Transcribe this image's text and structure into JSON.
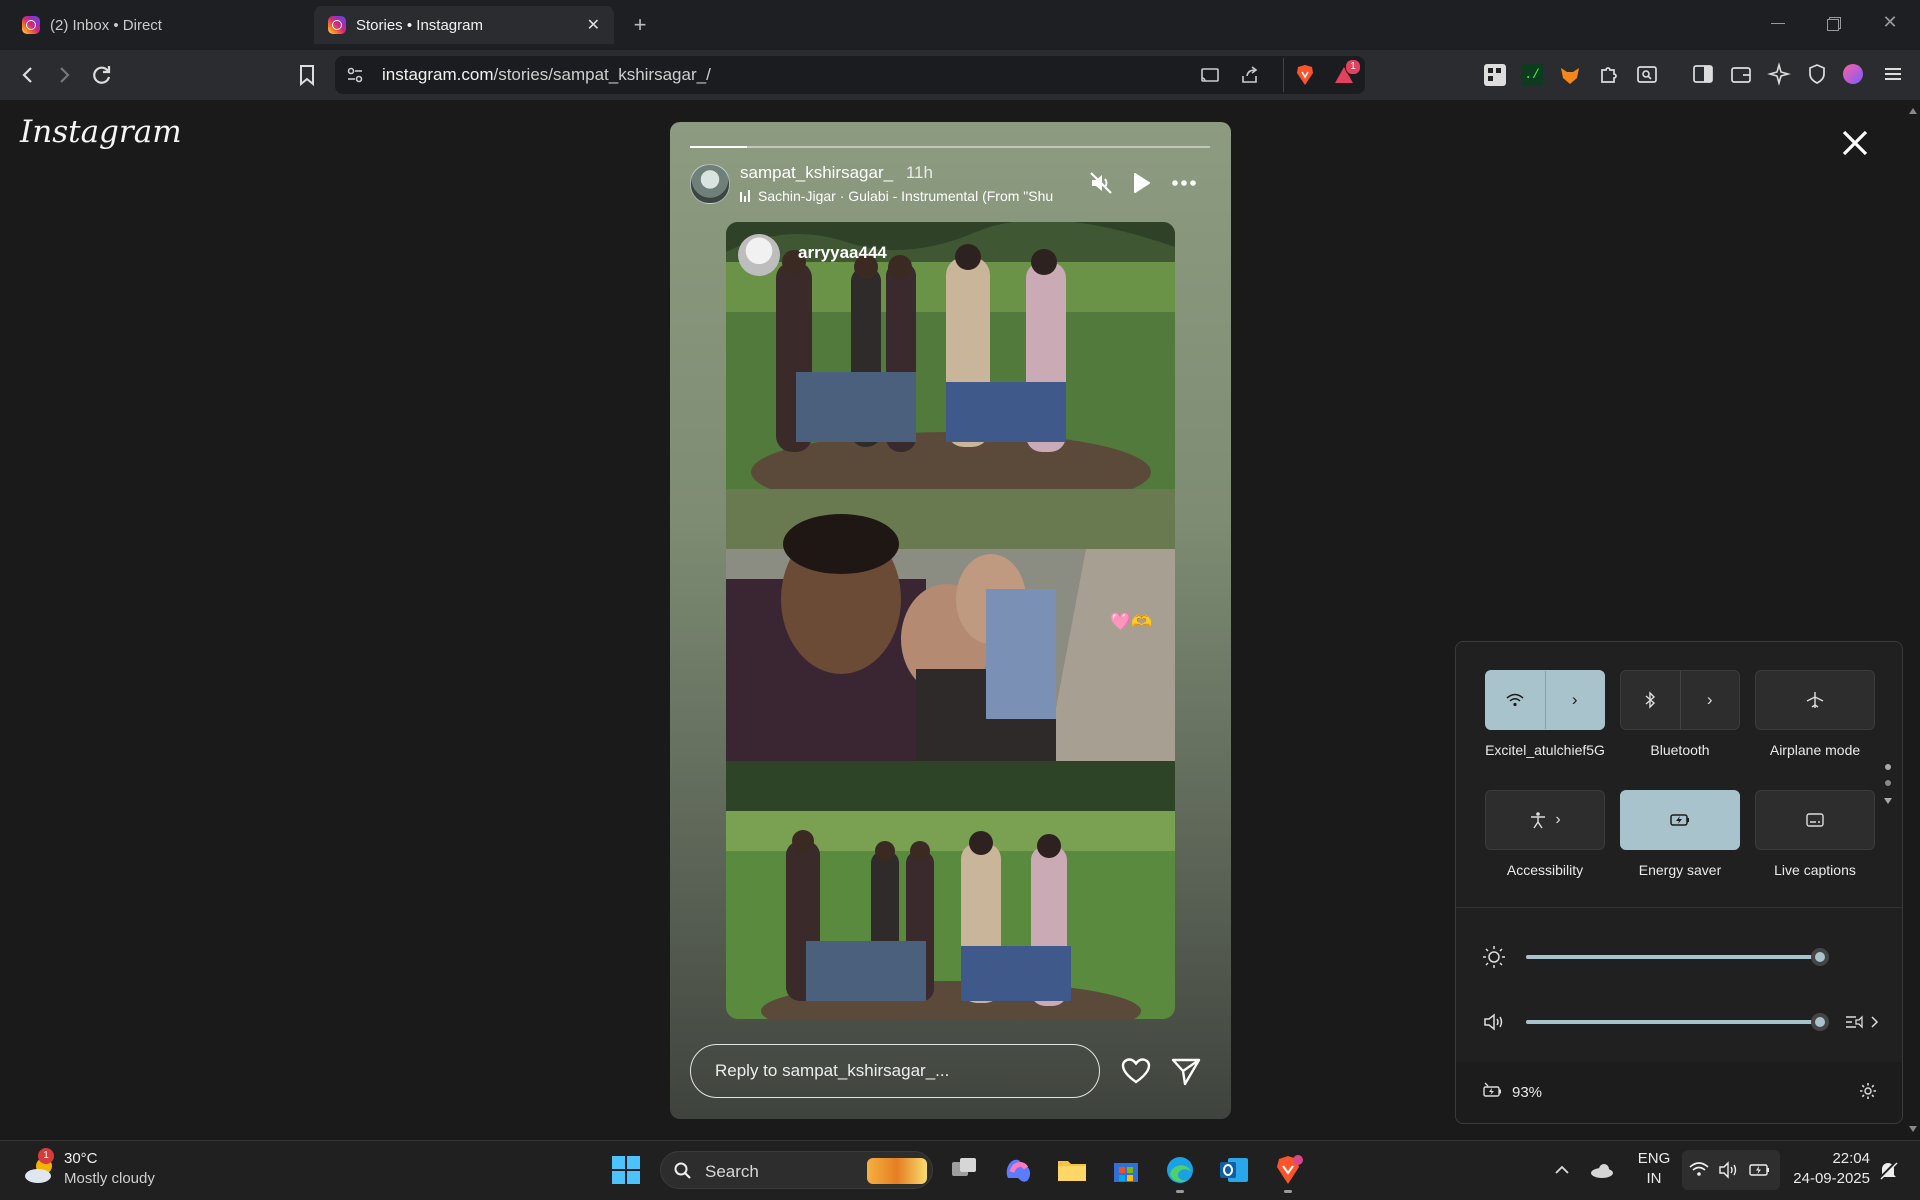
{
  "browser": {
    "tabs": [
      {
        "label": "(2) Inbox • Direct",
        "active": false
      },
      {
        "label": "Stories • Instagram",
        "active": true
      }
    ],
    "url_domain": "instagram.com",
    "url_path": "/stories/sampat_kshirsagar_/",
    "notification_count": "1"
  },
  "instagram": {
    "logo_text": "Instagram"
  },
  "story": {
    "username": "sampat_kshirsagar_",
    "time_ago": "11h",
    "music_text": "Sachin-Jigar · Gulabi - Instrumental (From \"Shu",
    "tagged_user": "arryyaa444",
    "sticker": "🩷🫶",
    "progress": 0.11,
    "reply_placeholder": "Reply to sampat_kshirsagar_...",
    "icons": [
      "mute-icon",
      "play-icon",
      "more-icon",
      "heart-icon",
      "send-icon",
      "close-icon"
    ]
  },
  "quick_settings": {
    "tiles": [
      {
        "label": "Excitel_atulchief5G",
        "icon": "wifi-icon",
        "on": true
      },
      {
        "label": "Bluetooth",
        "icon": "bluetooth-icon",
        "on": false
      },
      {
        "label": "Airplane mode",
        "icon": "airplane-icon",
        "on": false
      },
      {
        "label": "Accessibility",
        "icon": "accessibility-icon",
        "on": false
      },
      {
        "label": "Energy saver",
        "icon": "energy-saver-icon",
        "on": true
      },
      {
        "label": "Live captions",
        "icon": "captions-icon",
        "on": false
      }
    ],
    "brightness": 1.0,
    "volume": 1.0,
    "battery": "93%",
    "accent": "#a9c3cc"
  },
  "taskbar": {
    "weather_temp": "30°C",
    "weather_desc": "Mostly cloudy",
    "weather_badge": "1",
    "search_label": "Search",
    "language": "ENG",
    "region": "IN",
    "time": "22:04",
    "date": "24-09-2025"
  }
}
